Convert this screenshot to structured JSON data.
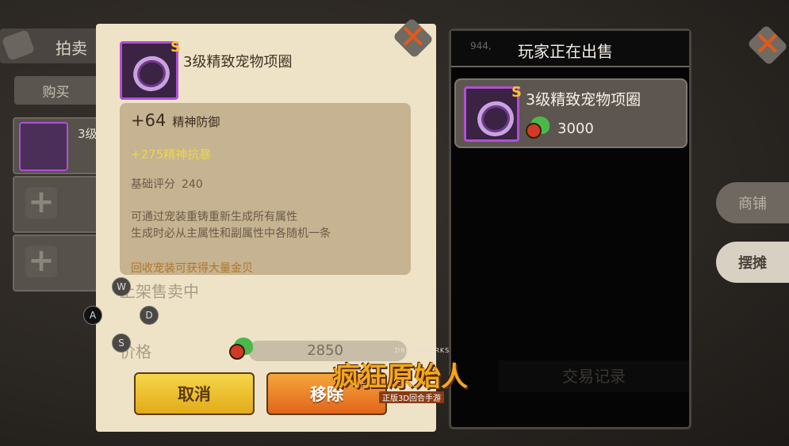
{
  "background": {
    "auction_tab": "拍卖",
    "buy_tab": "购买",
    "slot_partial_text": "3级"
  },
  "right_panel": {
    "coins": "944,",
    "title": "玩家正在出售",
    "listing": {
      "name": "3级精致宠物项圈",
      "price": "3000"
    },
    "trade_record": "交易记录"
  },
  "side_buttons": {
    "shop": "商铺",
    "stall": "摆摊"
  },
  "modal": {
    "item_name": "3级精致宠物项圈",
    "badge": "S",
    "stat": {
      "value": "+64",
      "name": "精神防御"
    },
    "bonus": "+275精神抗暴",
    "score": {
      "label": "基础评分",
      "value": "240"
    },
    "description": "可通过宠装重铸重新生成所有属性\n生成时必从主属性和副属性中各随机一条",
    "recycle": "回收宠装可获得大量金贝",
    "listing_status": "上架售卖中",
    "price_label": "价格",
    "price_value": "2850",
    "cancel_label": "取消",
    "remove_label": "移除"
  },
  "key_hints": {
    "w": "W",
    "a": "A",
    "s": "S",
    "d": "D"
  },
  "logo": {
    "brand": "DREAMWORKS",
    "main": "疯狂原始人",
    "sub": "正版3D回合手游"
  },
  "colors": {
    "accent_orange": "#e05a1b",
    "rarity_purple": "#b04fd6",
    "bonus_yellow": "#ead84a",
    "recycle_gold": "#b0762a"
  }
}
